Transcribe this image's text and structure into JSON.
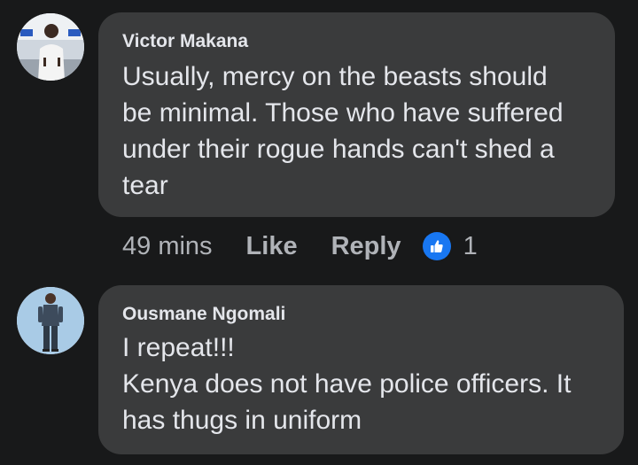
{
  "comments": [
    {
      "author": "Victor Makana",
      "avatar_icon": "user-avatar-photo",
      "text_lines": [
        "Usually, mercy on the beasts should",
        "be minimal. Those who have suffered",
        "under their rogue hands can't shed a",
        "tear"
      ],
      "time": "49 mins",
      "like_label": "Like",
      "reply_label": "Reply",
      "reaction_icon": "thumbs-up-icon",
      "reaction_count": "1"
    },
    {
      "author": "Ousmane Ngomali",
      "avatar_icon": "user-avatar-photo",
      "text_lines": [
        "I repeat!!!",
        "Kenya does not have police officers. It",
        "has thugs in uniform"
      ]
    }
  ],
  "colors": {
    "background": "#18191a",
    "bubble": "#3a3b3c",
    "text": "#e4e6eb",
    "secondary_text": "#b0b3b8",
    "reaction_blue": "#1877f2"
  }
}
